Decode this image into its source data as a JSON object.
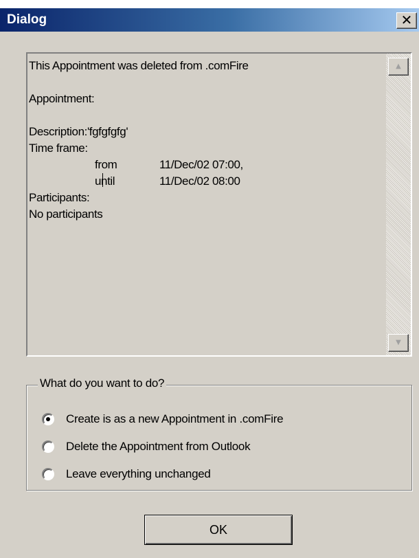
{
  "window": {
    "title": "Dialog",
    "close_glyph": "✕",
    "close_icon": "close-icon"
  },
  "memo": {
    "lines": [
      "This Appointment was deleted from .comFire",
      "",
      "Appointment:",
      "",
      "Description:'fgfgfgfg'",
      "Time frame:",
      "Participants:",
      "No participants"
    ],
    "from_label": "from",
    "from_value": "11/Dec/02 07:00,",
    "until_label": "until",
    "until_value": "11/Dec/02 08:00"
  },
  "scrollbar": {
    "up_icon": "scroll-up-arrow-icon",
    "down_icon": "scroll-down-arrow-icon"
  },
  "options": {
    "legend": "What do you want to do?",
    "items": [
      {
        "label": "Create is as a new Appointment in .comFire",
        "selected": true
      },
      {
        "label": "Delete the Appointment from Outlook",
        "selected": false
      },
      {
        "label": "Leave everything unchanged",
        "selected": false
      }
    ]
  },
  "ok_label": "OK"
}
